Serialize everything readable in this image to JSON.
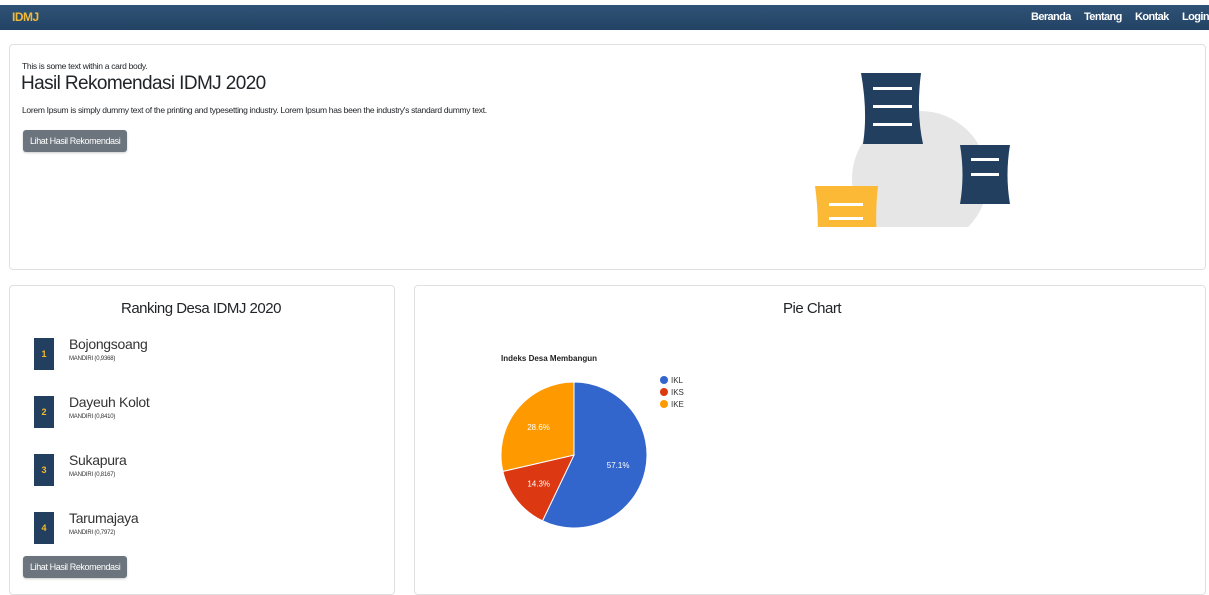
{
  "navbar": {
    "brand": "IDMJ",
    "links": [
      "Beranda",
      "Tentang",
      "Kontak",
      "Login"
    ]
  },
  "hero": {
    "small_text": "This is some text within a card body.",
    "title": "Hasil Rekomendasi IDMJ 2020",
    "description": "Lorem Ipsum is simply dummy text of the printing and typesetting industry. Lorem Ipsum has been the industry's standard dummy text.",
    "button_label": "Lihat Hasil Rekomendasi"
  },
  "ranking": {
    "title": "Ranking Desa IDMJ 2020",
    "items": [
      {
        "rank": "1",
        "name": "Bojongsoang",
        "status": "MANDIRI (0,9368)"
      },
      {
        "rank": "2",
        "name": "Dayeuh Kolot",
        "status": "MANDIRI (0,8410)"
      },
      {
        "rank": "3",
        "name": "Sukapura",
        "status": "MANDIRI (0,8167)"
      },
      {
        "rank": "4",
        "name": "Tarumajaya",
        "status": "MANDIRI (0,7972)"
      }
    ],
    "button_label": "Lihat Hasil Rekomendasi"
  },
  "pie_card": {
    "title": "Pie Chart"
  },
  "chart_data": {
    "type": "pie",
    "title": "Indeks Desa Membangun",
    "labels": [
      "IKL",
      "IKS",
      "IKE"
    ],
    "values": [
      57.1,
      14.3,
      28.6
    ],
    "value_labels": [
      "57.1%",
      "14.3%",
      "28.6%"
    ],
    "colors": [
      "#3366cc",
      "#dc3912",
      "#ff9900"
    ],
    "legend_position": "right"
  },
  "colors": {
    "navbar": "#2a4b6e",
    "brand_accent": "#f0b93a",
    "rank_badge": "#223f5f",
    "button": "#6c757d"
  }
}
